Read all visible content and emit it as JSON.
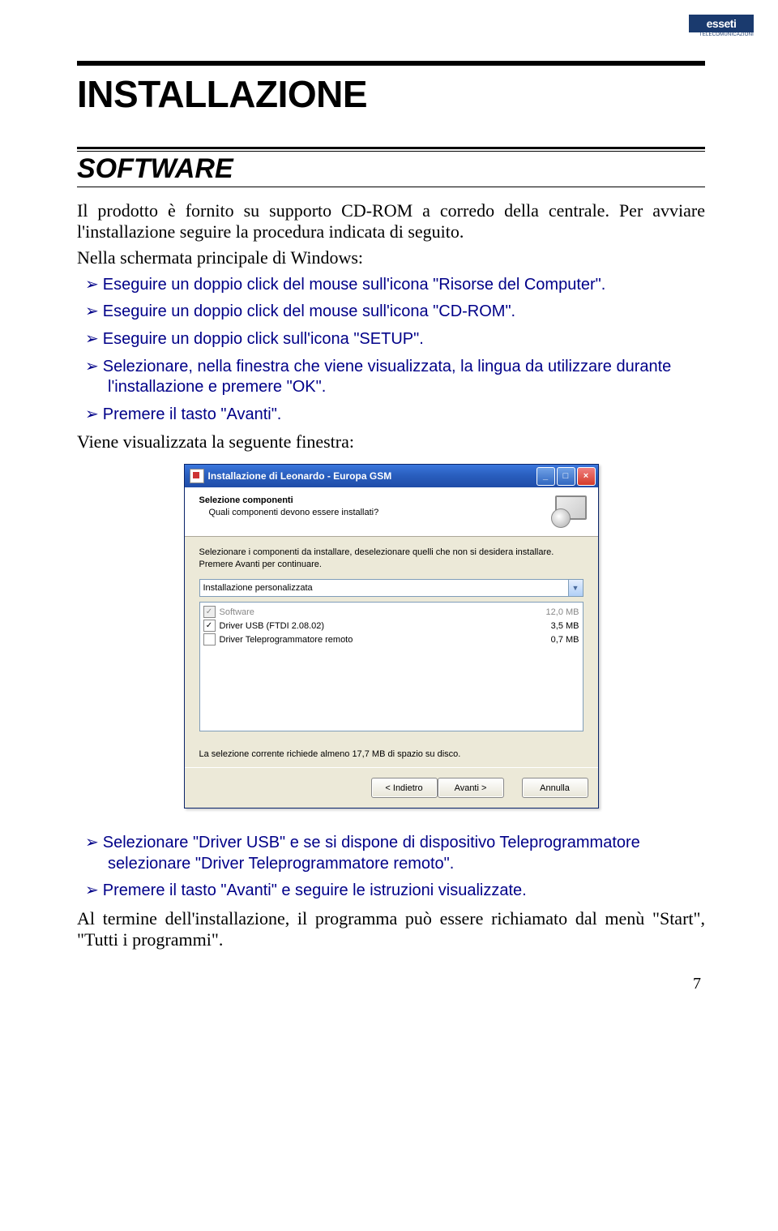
{
  "logo": {
    "text": "esseti",
    "sub": "TELECOMUNICAZIONI"
  },
  "title": "INSTALLAZIONE",
  "section": "SOFTWARE",
  "intro1": "Il prodotto è fornito su supporto CD-ROM a corredo della centrale. Per avviare l'installazione seguire la procedura indicata di seguito.",
  "intro2": "Nella schermata principale di Windows:",
  "steps1": [
    "Eseguire un doppio click del mouse sull'icona \"Risorse del Computer\".",
    "Eseguire un doppio click del mouse sull'icona \"CD-ROM\".",
    "Eseguire un doppio click sull'icona \"SETUP\".",
    "Selezionare, nella finestra che viene visualizzata, la lingua da utilizzare durante l'installazione e premere \"OK\".",
    "Premere il tasto \"Avanti\"."
  ],
  "after1": "Viene visualizzata la seguente finestra:",
  "installer": {
    "title": "Installazione di Leonardo - Europa GSM",
    "header_title": "Selezione componenti",
    "header_sub": "Quali componenti devono essere installati?",
    "desc": "Selezionare i componenti da installare, deselezionare quelli che non si desidera installare. Premere Avanti per continuare.",
    "combo": "Installazione personalizzata",
    "components": [
      {
        "label": "Software",
        "size": "12,0 MB",
        "checked": true,
        "disabled": true
      },
      {
        "label": "Driver USB (FTDI 2.08.02)",
        "size": "3,5 MB",
        "checked": true,
        "disabled": false
      },
      {
        "label": "Driver Teleprogrammatore remoto",
        "size": "0,7 MB",
        "checked": false,
        "disabled": false
      }
    ],
    "disk_note": "La selezione corrente richiede almeno 17,7 MB di spazio su disco.",
    "btn_back": "< Indietro",
    "btn_next": "Avanti >",
    "btn_cancel": "Annulla"
  },
  "steps2": [
    "Selezionare \"Driver USB\" e se si dispone di dispositivo Teleprogrammatore selezionare \"Driver Teleprogrammatore remoto\".",
    "Premere il tasto \"Avanti\" e seguire le istruzioni visualizzate."
  ],
  "closing": "Al termine dell'installazione, il programma può essere richiamato dal menù \"Start\", \"Tutti i programmi\".",
  "page_num": "7"
}
